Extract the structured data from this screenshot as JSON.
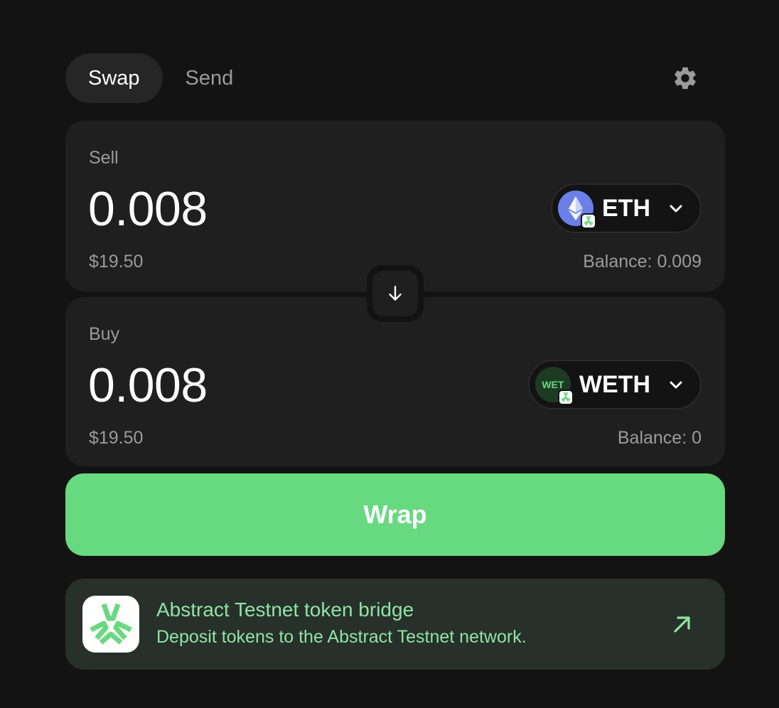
{
  "tabs": [
    {
      "label": "Swap",
      "active": true
    },
    {
      "label": "Send",
      "active": false
    }
  ],
  "icons": {
    "settings": "gear-icon",
    "switch": "arrow-down-icon",
    "token_dropdown": "chevron-down-icon",
    "bridge_link": "arrow-up-right-icon"
  },
  "sell": {
    "label": "Sell",
    "amount": "0.008",
    "usd_value": "$19.50",
    "balance": "Balance: 0.009",
    "token": {
      "symbol": "ETH",
      "icon": "eth-icon",
      "icon_color": "#6a7fe8"
    }
  },
  "buy": {
    "label": "Buy",
    "amount": "0.008",
    "usd_value": "$19.50",
    "balance": "Balance: 0",
    "token": {
      "symbol": "WETH",
      "icon_text": "WET",
      "icon_color": "#1d3a22"
    }
  },
  "action_button": {
    "label": "Wrap",
    "color": "#67d97e"
  },
  "bridge": {
    "title": "Abstract Testnet token bridge",
    "subtitle": "Deposit tokens to the Abstract Testnet network.",
    "accent": "#8fe4a3"
  }
}
